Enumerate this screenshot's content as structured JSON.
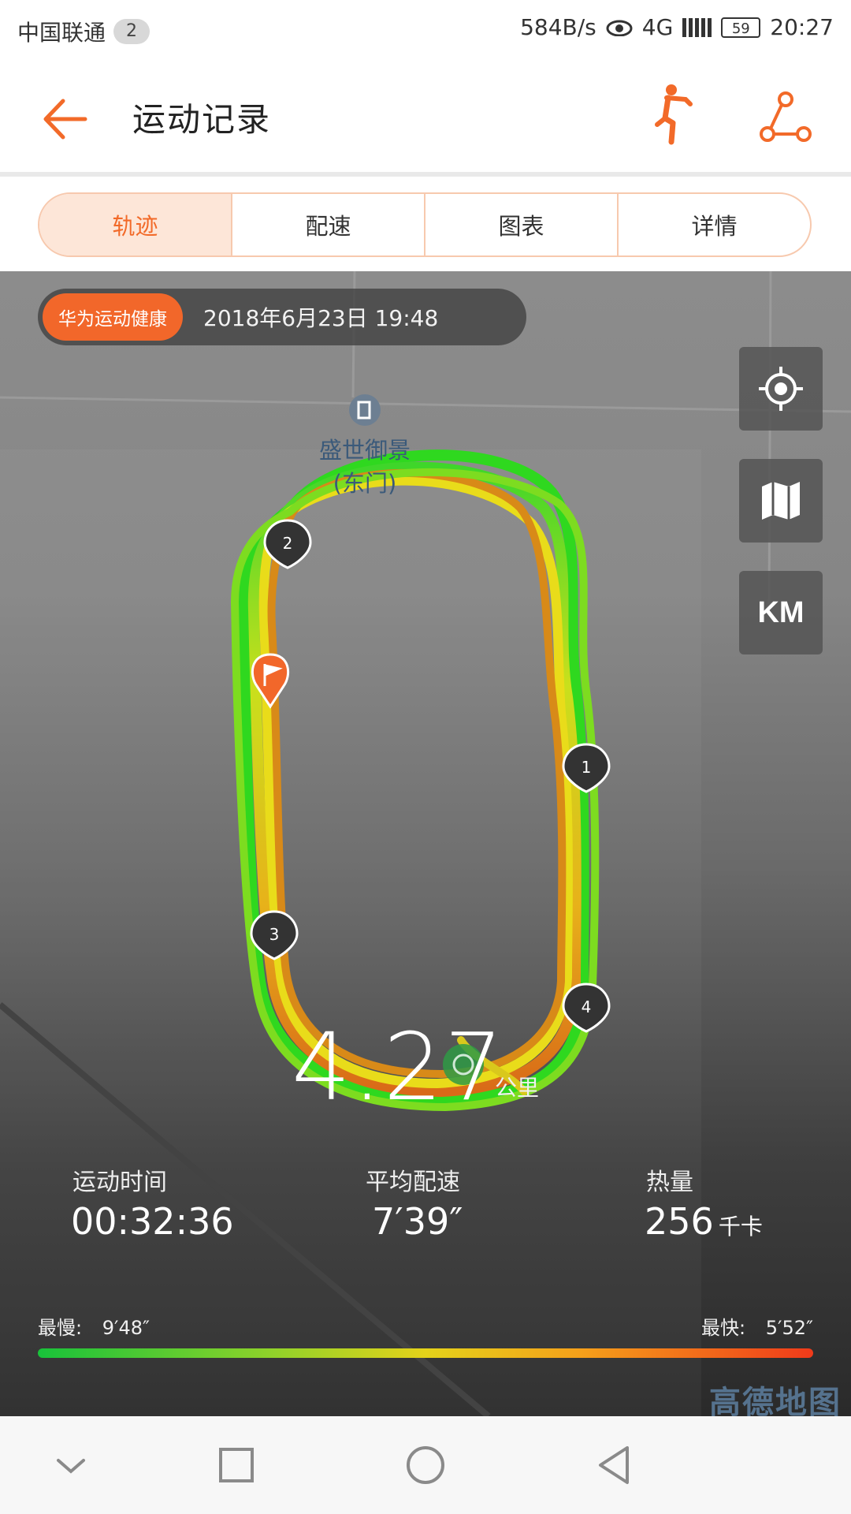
{
  "status_bar": {
    "carrier": "中国联通",
    "sim_badge": "2",
    "net_speed": "584B/s",
    "network": "4G",
    "battery": "59",
    "time": "20:27"
  },
  "header": {
    "title": "运动记录",
    "back_icon": "arrow-left-icon",
    "runner_icon": "runner-icon",
    "route_icon": "route-share-icon",
    "accent_color": "#f26a29"
  },
  "tabs": [
    {
      "label": "轨迹",
      "active": true
    },
    {
      "label": "配速",
      "active": false
    },
    {
      "label": "图表",
      "active": false
    },
    {
      "label": "详情",
      "active": false
    }
  ],
  "map": {
    "source_badge": "华为运动健康",
    "date": "2018年6月23日 19:48",
    "poi": {
      "name": "盛世御景",
      "sub": "(东门)"
    },
    "controls": {
      "locate_icon": "locate-icon",
      "map_icon": "map-icon",
      "km_label": "KM"
    },
    "km_markers": [
      "1",
      "2",
      "3",
      "4"
    ],
    "watermark": "高德地图"
  },
  "summary": {
    "distance": "4.27",
    "distance_unit": "公里",
    "stats": [
      {
        "label": "运动时间",
        "value": "00:32:36",
        "unit": ""
      },
      {
        "label": "平均配速",
        "value": "7′39″",
        "unit": ""
      },
      {
        "label": "热量",
        "value": "256",
        "unit": "千卡"
      }
    ]
  },
  "pace_scale": {
    "slowest_label": "最慢:",
    "slowest_value": "9′48″",
    "fastest_label": "最快:",
    "fastest_value": "5′52″",
    "colors": [
      "#18c23a",
      "#e4d21a",
      "#ef3a1a"
    ]
  },
  "nav_bar": {
    "back_icon": "nav-back-icon",
    "home_icon": "nav-home-icon",
    "recents_icon": "nav-recents-icon",
    "collapse_icon": "nav-collapse-icon"
  }
}
